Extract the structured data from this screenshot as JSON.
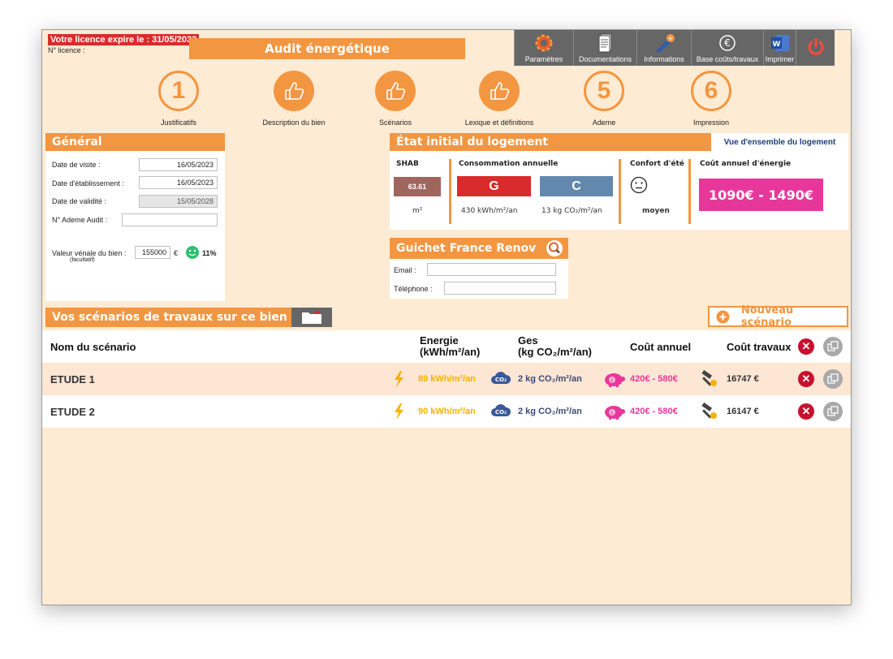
{
  "license": {
    "expiry": "Votre licence expire le : 31/05/2033",
    "number_label": "N° licence :"
  },
  "app_title": "Audit énergétique",
  "toolbar": {
    "settings": "Paramètres",
    "docs": "Documentations",
    "info": "Informations",
    "costs": "Base coûts/travaux",
    "print": "Imprimer"
  },
  "steps": [
    {
      "badge": "1",
      "label": "Justificatifs"
    },
    {
      "badge": "",
      "label": "Description du bien"
    },
    {
      "badge": "",
      "label": "Scénarios"
    },
    {
      "badge": "",
      "label": "Lexique et définitions"
    },
    {
      "badge": "5",
      "label": "Ademe"
    },
    {
      "badge": "6",
      "label": "Impression"
    }
  ],
  "general": {
    "title": "Général",
    "visit_label": "Date de visite :",
    "visit_value": "16/05/2023",
    "estab_label": "Date d'établissement :",
    "estab_value": "16/05/2023",
    "validity_label": "Date de validité :",
    "validity_value": "15/05/2028",
    "ademe_label": "N° Ademe Audit :",
    "ademe_value": "",
    "venal_label": "Valeur vénale du bien :",
    "venal_sub": "(facultatif)",
    "venal_value": "155000",
    "currency": "€",
    "percent": "11%"
  },
  "etat": {
    "title": "État initial du logement",
    "overview_tab": "Vue d'ensemble du logement",
    "shab_title": "SHAB",
    "shab_value": "63.61",
    "shab_unit": "m²",
    "conso_title": "Consommation annuelle",
    "energy_class": "G",
    "ges_class": "C",
    "energy_value": "430 kWh/m²/an",
    "ges_value": "13 kg CO₂/m²/an",
    "comfort_title": "Confort d'été",
    "comfort_value": "moyen",
    "cost_title": "Coût annuel d'énergie",
    "cost_value": "1090€ - 1490€"
  },
  "guichet": {
    "title": "Guichet France Renov",
    "email_label": "Email :",
    "email_value": "",
    "phone_label": "Téléphone :",
    "phone_value": ""
  },
  "scenarios": {
    "title": "Vos scénarios de travaux sur ce bien",
    "new_button": "Nouveau scénario",
    "headers": {
      "name": "Nom du scénario",
      "energy_1": "Energie",
      "energy_2": "(kWh/m²/an)",
      "ges_1": "Ges",
      "ges_2": "(kg CO₂/m²/an)",
      "cost": "Coût annuel",
      "works": "Coût travaux"
    },
    "rows": [
      {
        "name": "ETUDE 1",
        "energy": "89 kWh/m²/an",
        "ges": "2 kg CO₂/m²/an",
        "cost": "420€ - 580€",
        "works": "16747 €"
      },
      {
        "name": "ETUDE 2",
        "energy": "90 kWh/m²/an",
        "ges": "2 kg CO₂/m²/an",
        "cost": "420€ - 580€",
        "works": "16147 €"
      }
    ]
  },
  "colors": {
    "accent": "#f39641",
    "background": "#fdebd3",
    "class_g": "#d92b2b",
    "class_c": "#6289ad",
    "shab": "#a0655d",
    "cost": "#e8379a",
    "energy": "#f5b300"
  }
}
